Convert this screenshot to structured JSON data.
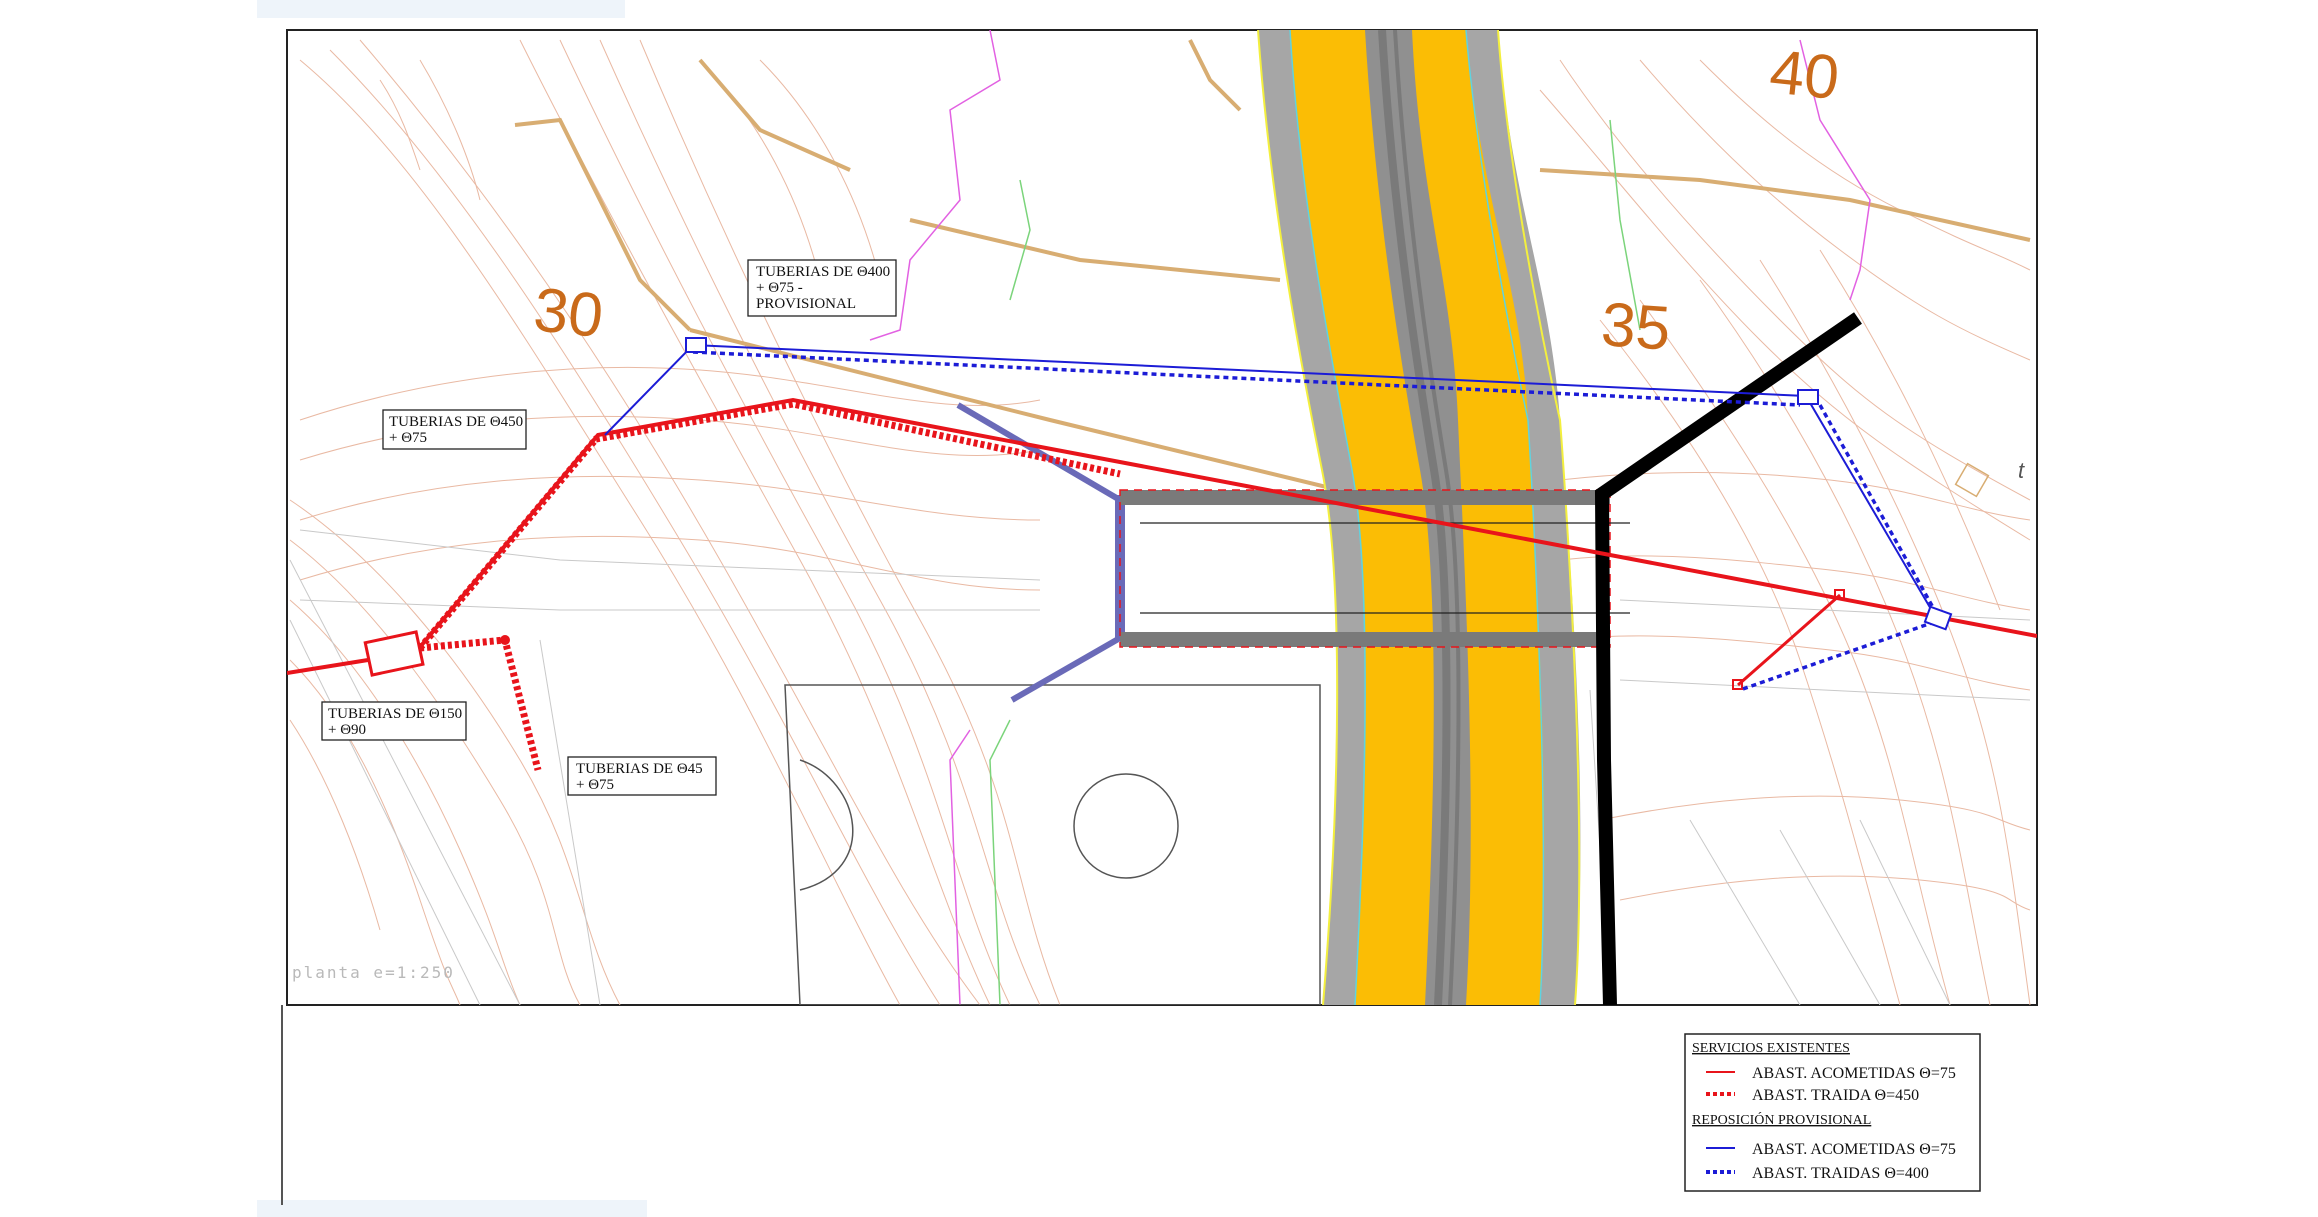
{
  "chainage_marks": [
    "30",
    "35",
    "40"
  ],
  "scale_caption": "planta e=1:250",
  "edge_fragment": "t",
  "callouts": [
    {
      "id": "o400",
      "lines": [
        "TUBERIAS DE Θ400",
        "+ Θ75 -",
        "PROVISIONAL"
      ]
    },
    {
      "id": "o450",
      "lines": [
        "TUBERIAS DE Θ450",
        "+ Θ75"
      ]
    },
    {
      "id": "o150",
      "lines": [
        "TUBERIAS DE Θ150",
        "+ Θ90"
      ]
    },
    {
      "id": "o45",
      "lines": [
        "TUBERIAS DE Θ45",
        "+ Θ75"
      ]
    }
  ],
  "legend": {
    "existing_heading": "SERVICIOS EXISTENTES",
    "existing_acometidas": "ABAST. ACOMETIDAS Θ=75",
    "existing_traida": "ABAST. TRAIDA Θ=450",
    "provisional_heading": "REPOSICIÓN PROVISIONAL",
    "provisional_acometidas": "ABAST. ACOMETIDAS Θ=75",
    "provisional_traidas": "ABAST. TRAIDAS Θ=400"
  },
  "colors": {
    "existing_network": "#e8141b",
    "provisional_network": "#1c1cd6",
    "road_surface": "#fbbd05",
    "road_shoulder": "#a6a6a6",
    "chainage": "#c96a1a",
    "new_boundary": "#000000",
    "contours": "#e9b9a3"
  }
}
